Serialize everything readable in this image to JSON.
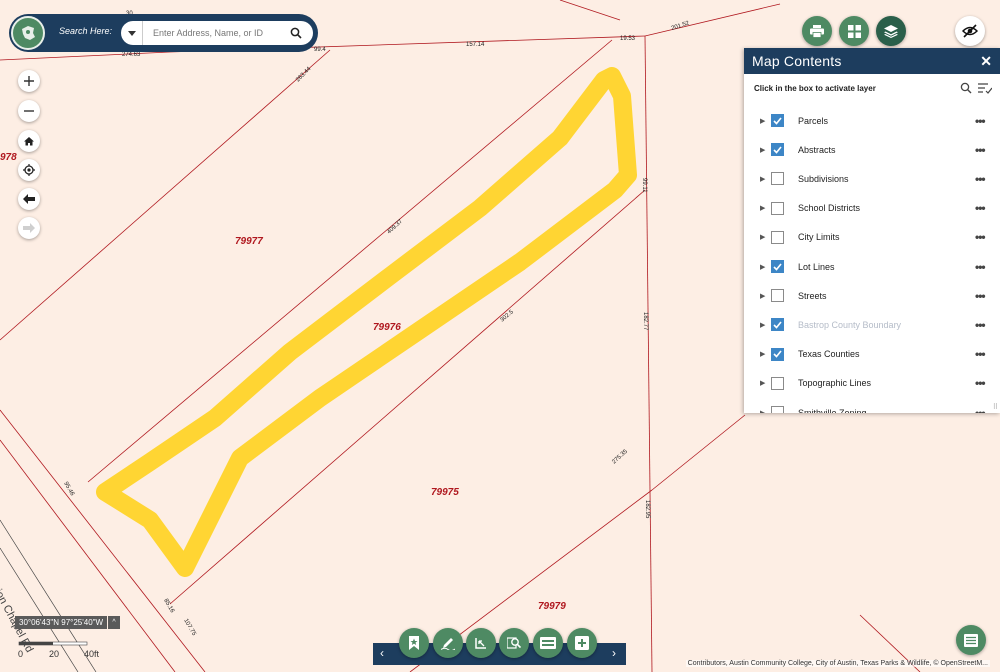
{
  "map": {
    "parcels": [
      "79977",
      "79976",
      "79975",
      "79979",
      "978"
    ],
    "dimensions": [
      "274.63",
      "99.4",
      "157.14",
      "19.53",
      "201.52",
      "263.44",
      "409.37",
      "99.11",
      "302.5",
      "182.77",
      "275.35",
      "182.95",
      "95.46",
      "85.16",
      "107.75",
      "30"
    ],
    "road_name": "Union Chapel Rd",
    "colors": {
      "background": "#fdeee4",
      "lines": "#b0181f",
      "highlight": "#ffd21f"
    }
  },
  "search": {
    "label": "Search Here:",
    "placeholder": "Enter Address, Name, or ID",
    "search_icon": "search-icon",
    "dropdown_icon": "caret-down-icon"
  },
  "map_controls": [
    "zoom-in-icon",
    "zoom-out-icon",
    "home-icon",
    "locate-icon",
    "arrow-left-icon",
    "arrow-right-icon"
  ],
  "top_buttons": [
    "print-icon",
    "grid-icon",
    "layers-icon",
    "eye-off-icon"
  ],
  "panel": {
    "title": "Map Contents",
    "close": "✕",
    "hint": "Click in the box to activate layer",
    "layers": [
      {
        "name": "Parcels",
        "checked": true,
        "dim": false
      },
      {
        "name": "Abstracts",
        "checked": true,
        "dim": false
      },
      {
        "name": "Subdivisions",
        "checked": false,
        "dim": false
      },
      {
        "name": "School Districts",
        "checked": false,
        "dim": false
      },
      {
        "name": "City Limits",
        "checked": false,
        "dim": false
      },
      {
        "name": "Lot Lines",
        "checked": true,
        "dim": false
      },
      {
        "name": "Streets",
        "checked": false,
        "dim": false
      },
      {
        "name": "Bastrop County Boundary",
        "checked": true,
        "dim": true
      },
      {
        "name": "Texas Counties",
        "checked": true,
        "dim": false
      },
      {
        "name": "Topographic Lines",
        "checked": false,
        "dim": false
      },
      {
        "name": "Smithville Zoning",
        "checked": false,
        "dim": false
      }
    ]
  },
  "coords": {
    "text": "30°06'43\"N 97°25'40\"W",
    "toggle": "^"
  },
  "scale": {
    "labels": [
      "0",
      "20",
      "40ft"
    ]
  },
  "toolbar": {
    "prev": "‹",
    "next": "›",
    "tools": [
      "bookmark-icon",
      "draw-icon",
      "measure-icon",
      "identify-icon",
      "print-layout-icon",
      "add-data-icon"
    ]
  },
  "table_button": "table-icon",
  "attribution": "Contributors, Austin Community College, City of Austin, Texas Parks & Wildlife, © OpenStreetM..."
}
